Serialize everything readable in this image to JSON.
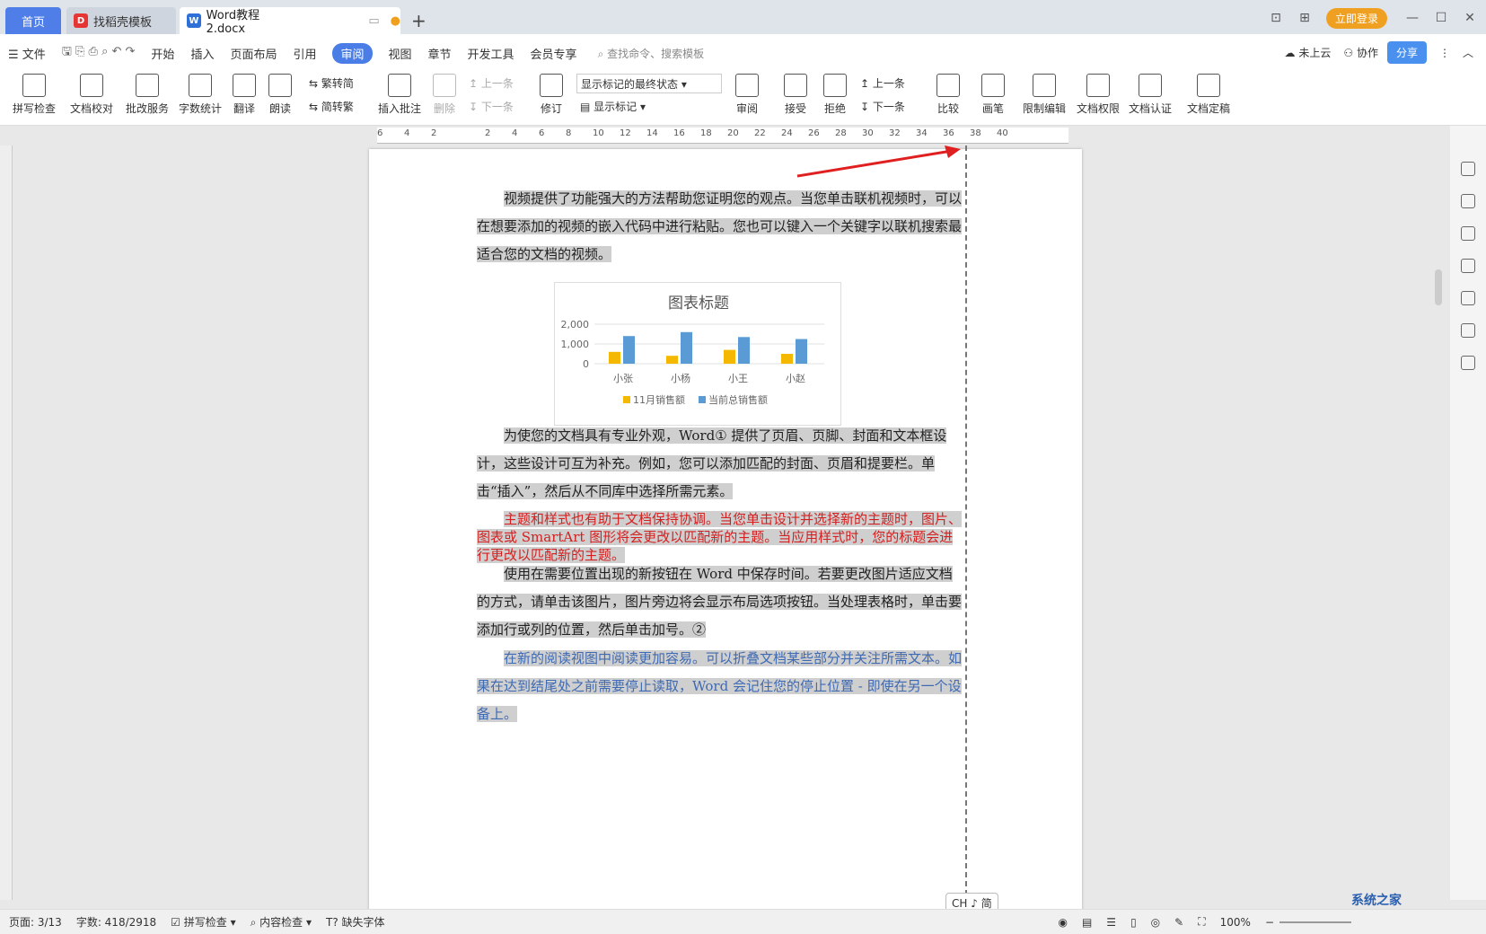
{
  "tabs": {
    "home": "首页",
    "template": "找稻壳模板",
    "doc": "Word教程2.docx"
  },
  "topbar": {
    "login": "立即登录"
  },
  "menu": {
    "file": "文件",
    "items": [
      "开始",
      "插入",
      "页面布局",
      "引用",
      "审阅",
      "视图",
      "章节",
      "开发工具",
      "会员专享"
    ],
    "search": "查找命令、搜索模板",
    "cloud": "未上云",
    "collab": "协作",
    "share": "分享"
  },
  "ribbon": {
    "spell": "拼写检查",
    "proof": "文档校对",
    "batch": "批改服务",
    "wordcount": "字数统计",
    "translate": "翻译",
    "read": "朗读",
    "t2s": "繁转简",
    "s2t": "简转繁",
    "insert_comment": "插入批注",
    "delete": "删除",
    "prev": "上一条",
    "next": "下一条",
    "revise": "修订",
    "show_state": "显示标记的最终状态",
    "show_marks": "显示标记",
    "review": "审阅",
    "accept": "接受",
    "reject": "拒绝",
    "prev2": "上一条",
    "next2": "下一条",
    "compare": "比较",
    "pen": "画笔",
    "restrict": "限制编辑",
    "perm": "文档权限",
    "cert": "文档认证",
    "final": "文档定稿"
  },
  "ruler": {
    "labels": [
      "6",
      "4",
      "2",
      "",
      "2",
      "4",
      "6",
      "8",
      "10",
      "12",
      "14",
      "16",
      "18",
      "20",
      "22",
      "24",
      "26",
      "28",
      "30",
      "32",
      "34",
      "36",
      "38",
      "40"
    ]
  },
  "doc": {
    "p1": "视频提供了功能强大的方法帮助您证明您的观点。当您单击联机视频时，可以在想要添加的视频的嵌入代码中进行粘贴。您也可以键入一个关键字以联机搜索最适合您的文档的视频。",
    "p2": "为使您的文档具有专业外观，Word① 提供了页眉、页脚、封面和文本框设计，这些设计可互为补充。例如，您可以添加匹配的封面、页眉和提要栏。单击“插入”，然后从不同库中选择所需元素。",
    "p3": "主题和样式也有助于文档保持协调。当您单击设计并选择新的主题时，图片、图表或 SmartArt 图形将会更改以匹配新的主题。当应用样式时，您的标题会进行更改以匹配新的主题。",
    "p4": "使用在需要位置出现的新按钮在 Word 中保存时间。若要更改图片适应文档的方式，请单击该图片，图片旁边将会显示布局选项按钮。当处理表格时，单击要添加行或列的位置，然后单击加号。②",
    "p5": "在新的阅读视图中阅读更加容易。可以折叠文档某些部分并关注所需文本。如果在达到结尾处之前需要停止读取，Word 会记住您的停止位置 - 即使在另一个设备上。"
  },
  "chart_data": {
    "type": "bar",
    "title": "图表标题",
    "categories": [
      "小张",
      "小杨",
      "小王",
      "小赵"
    ],
    "series": [
      {
        "name": "11月销售额",
        "values": [
          600,
          400,
          700,
          500
        ],
        "color": "#f5b800"
      },
      {
        "name": "当前总销售额",
        "values": [
          1400,
          1600,
          1350,
          1250
        ],
        "color": "#5b9bd5"
      }
    ],
    "yticks": [
      "2,000",
      "1,000",
      "0"
    ],
    "ylim": [
      0,
      2000
    ]
  },
  "status": {
    "page": "页面: 3/13",
    "words": "字数: 418/2918",
    "spell": "拼写检查",
    "content": "内容检查",
    "font": "缺失字体",
    "zoom": "100%",
    "ime": "CH ♪ 简"
  },
  "watermark": "系统之家"
}
